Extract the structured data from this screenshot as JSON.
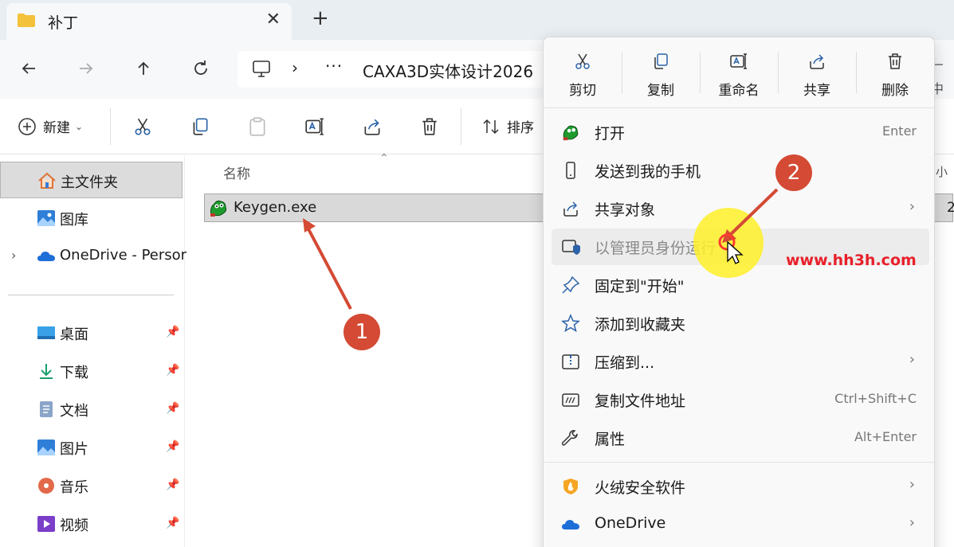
{
  "window": {
    "tab_title": "补丁",
    "close_glyph": "✕",
    "new_tab_glyph": "+"
  },
  "nav": {
    "address_chevron": "›",
    "address_more": "···",
    "address_path": "CAXA3D实体设计2026",
    "search_peek": "厂 中"
  },
  "toolbar": {
    "new_label": "新建",
    "sort_label": "排序"
  },
  "sidebar": {
    "home": "主文件夹",
    "gallery": "图库",
    "onedrive": "OneDrive - Persor",
    "quick_access": [
      {
        "label": "桌面",
        "icon": "desktop-icon"
      },
      {
        "label": "下载",
        "icon": "download-icon"
      },
      {
        "label": "文档",
        "icon": "documents-icon"
      },
      {
        "label": "图片",
        "icon": "pictures-icon"
      },
      {
        "label": "音乐",
        "icon": "music-icon"
      },
      {
        "label": "视频",
        "icon": "videos-icon"
      }
    ]
  },
  "files": {
    "column_name": "名称",
    "column_peek": "小",
    "row_peek": "2",
    "items": [
      {
        "name": "Keygen.exe"
      }
    ]
  },
  "context_menu": {
    "quick_actions": [
      {
        "label": "剪切",
        "icon": "cut-icon"
      },
      {
        "label": "复制",
        "icon": "copy-icon"
      },
      {
        "label": "重命名",
        "icon": "rename-icon"
      },
      {
        "label": "共享",
        "icon": "share-icon"
      },
      {
        "label": "删除",
        "icon": "delete-icon"
      }
    ],
    "items": [
      {
        "label": "打开",
        "shortcut": "Enter"
      },
      {
        "label": "发送到我的手机"
      },
      {
        "label": "共享对象",
        "submenu": "›"
      },
      {
        "label": "以管理员身份运行"
      },
      {
        "label": "固定到\"开始\""
      },
      {
        "label": "添加到收藏夹"
      },
      {
        "label": "压缩到...",
        "submenu": "›"
      },
      {
        "label": "复制文件地址",
        "shortcut": "Ctrl+Shift+C"
      },
      {
        "label": "属性",
        "shortcut": "Alt+Enter"
      },
      {
        "label": "火绒安全软件",
        "submenu": "›"
      },
      {
        "label": "OneDrive",
        "submenu": "›"
      }
    ]
  },
  "annotations": {
    "step1": "1",
    "step2": "2",
    "watermark": "www.hh3h.com",
    "arrow_color": "#d44a34",
    "highlight_color": "#fff028"
  }
}
